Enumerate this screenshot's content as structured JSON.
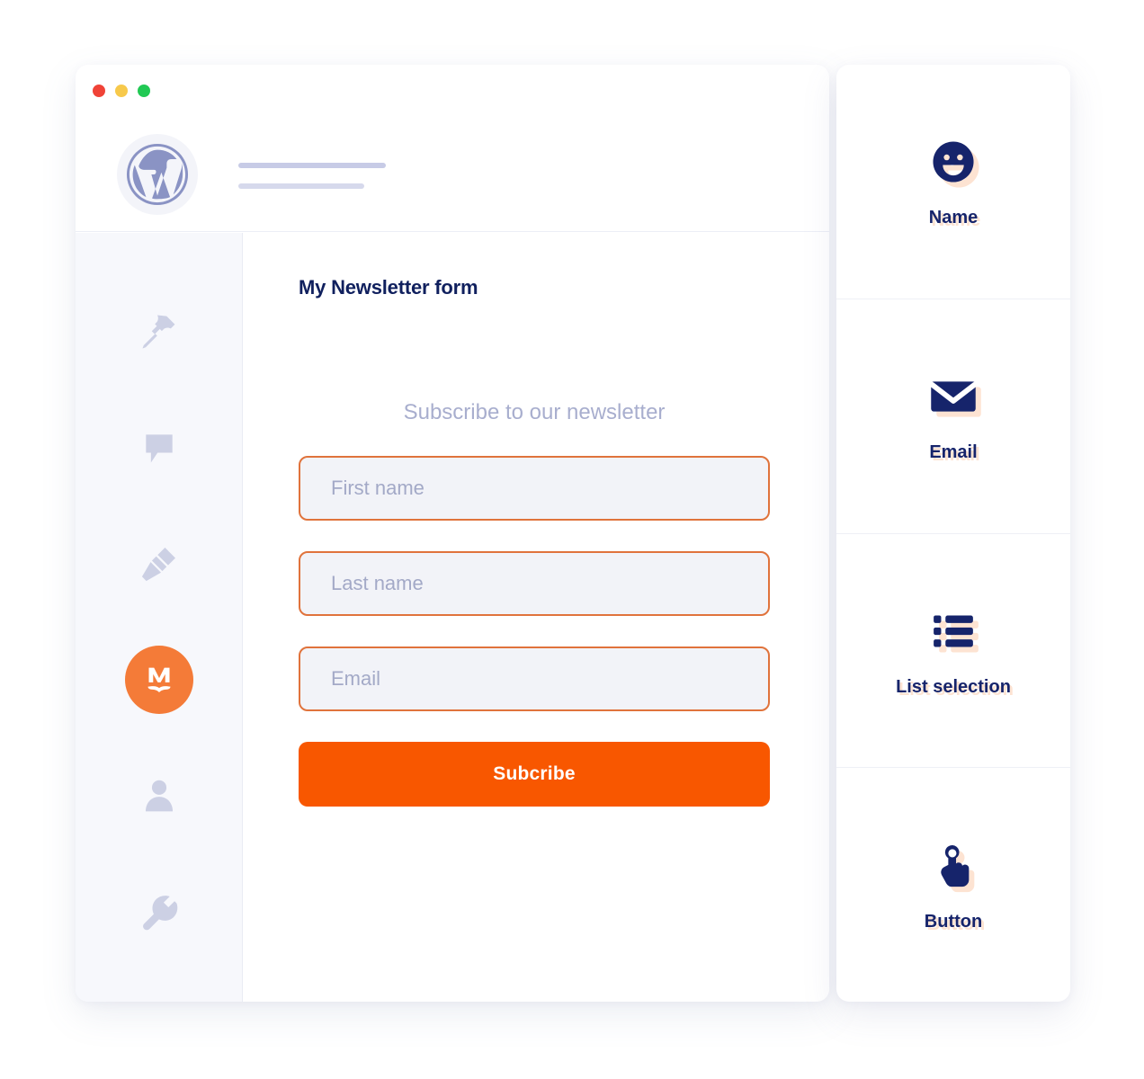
{
  "window": {
    "traffic_lights": [
      {
        "name": "close",
        "color": "#f04337"
      },
      {
        "name": "minimize",
        "color": "#f7c94b"
      },
      {
        "name": "maximize",
        "color": "#21c954"
      }
    ],
    "header": {
      "logo_icon": "wordpress-icon",
      "placeholder_lines": 2
    }
  },
  "sidebar": {
    "items": [
      {
        "icon": "pin-icon",
        "name": "pin"
      },
      {
        "icon": "comment-icon",
        "name": "comments"
      },
      {
        "icon": "paintbrush-icon",
        "name": "appearance"
      },
      {
        "icon": "mailpoet-icon",
        "name": "mailpoet",
        "active": true,
        "letter": "M",
        "color": "#f47b38"
      },
      {
        "icon": "user-icon",
        "name": "users"
      },
      {
        "icon": "wrench-icon",
        "name": "tools"
      }
    ]
  },
  "editor": {
    "title": "My Newsletter form",
    "form": {
      "subtitle": "Subscribe to our newsletter",
      "fields": [
        {
          "name": "first-name",
          "placeholder": "First name",
          "value": ""
        },
        {
          "name": "last-name",
          "placeholder": "Last name",
          "value": ""
        },
        {
          "name": "email",
          "placeholder": "Email",
          "value": ""
        }
      ],
      "submit_label": "Subcribe",
      "submit_color": "#f85700",
      "field_border_color": "#e0733c",
      "field_background": "#f2f3f8",
      "placeholder_color": "#a3a9c7"
    }
  },
  "blocks_panel": {
    "items": [
      {
        "label": "Name",
        "icon": "smiley-face-icon"
      },
      {
        "label": "Email",
        "icon": "envelope-icon"
      },
      {
        "label": "List selection",
        "icon": "bulleted-list-icon"
      },
      {
        "label": "Button",
        "icon": "tap-hand-icon"
      }
    ],
    "icon_color": "#16246b",
    "icon_shadow_color": "#fde3d2"
  }
}
